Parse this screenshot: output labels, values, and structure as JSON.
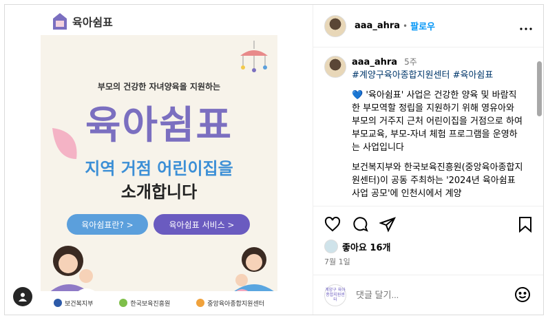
{
  "media": {
    "brand_name": "육아쉼표",
    "poster": {
      "subtitle": "부모의 건강한 자녀양육을 지원하는",
      "title": "육아쉼표",
      "headline": "지역 거점 어린이집을",
      "headline2": "소개합니다",
      "button_a": "육아쉼표란? >",
      "button_b": "육아쉼표 서비스 >",
      "footer": [
        "보건복지부",
        "한국보육진흥원",
        "중앙육아종합지원센터"
      ]
    }
  },
  "post": {
    "username": "aaa_ahra",
    "separator": "•",
    "follow_label": "팔로우",
    "more_icon": "more-icon",
    "caption": {
      "username": "aaa_ahra",
      "time": "5주",
      "tags": "#계양구육아종합지원센터 #육아쉼표",
      "paragraph1": "💙 '육아쉼표' 사업은 건강한 양육 및 바람직한 부모역할 정립을 지원하기 위해 영유아와 부모의 거주지 근처 어린이집을 거점으로 하여 부모교육, 부모-자녀 체험 프로그램을 운영하는 사업입니다",
      "paragraph2": "보건복지부와 한국보육진흥원(중앙육아종합지원센터)이 공동 주최하는 '2024년 육아쉼표 사업 공모'에 인천시에서 계양"
    },
    "likes": "좋아요 16개",
    "date": "7월 1일",
    "comment_placeholder": "댓글 달기...",
    "commenter_avatar_text": "계양구 육아종합지원센터"
  },
  "colors": {
    "accent": "#0095f6",
    "poster_purple": "#7b6fc0",
    "poster_blue": "#3c8fd6"
  }
}
